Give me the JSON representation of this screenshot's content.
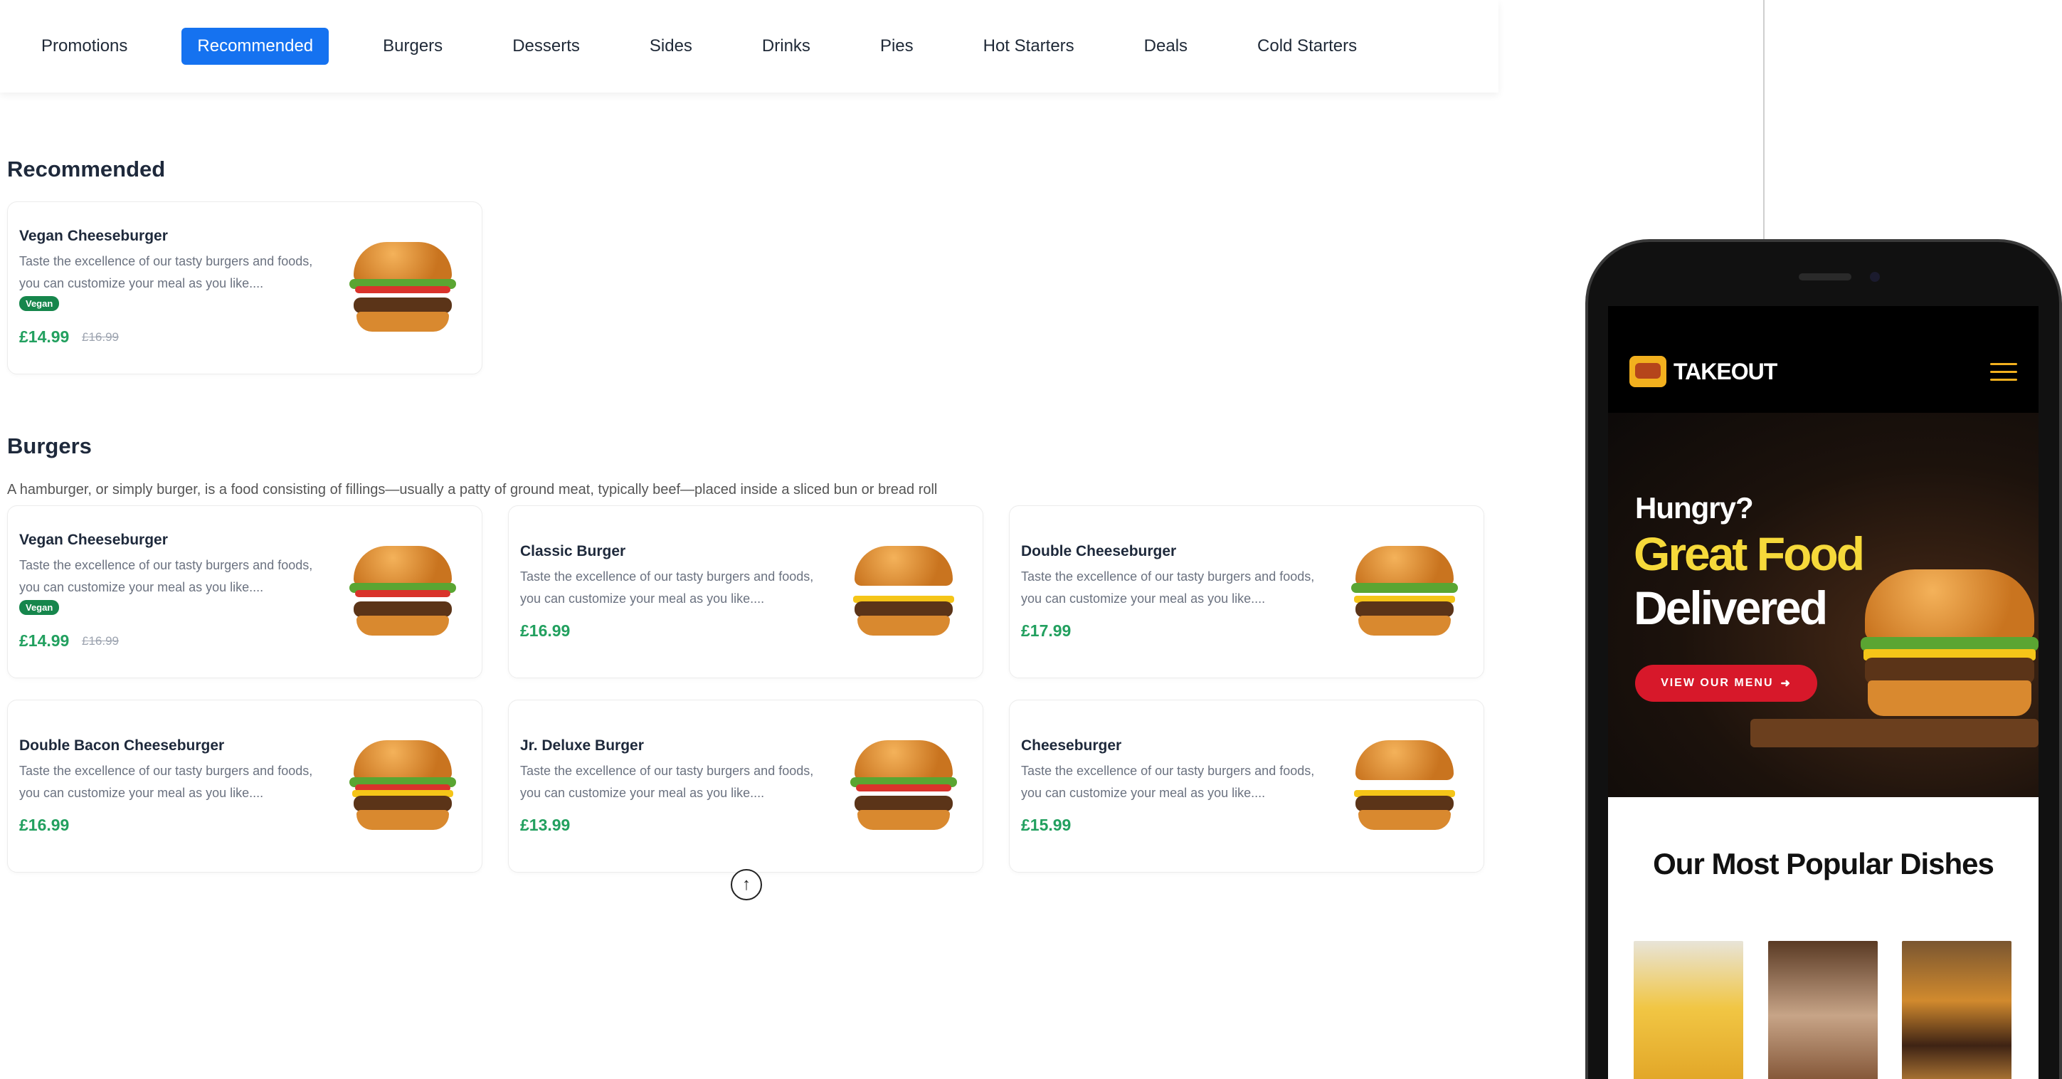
{
  "nav": {
    "items": [
      "Promotions",
      "Recommended",
      "Burgers",
      "Desserts",
      "Sides",
      "Drinks",
      "Pies",
      "Hot Starters",
      "Deals",
      "Cold Starters"
    ],
    "active": "Recommended"
  },
  "recommended": {
    "title": "Recommended",
    "items": [
      {
        "name": "Vegan Cheeseburger",
        "desc": "Taste the excellence of our tasty burgers and foods, you can customize your meal as you like....",
        "badge": "Vegan",
        "price": "£14.99",
        "old_price": "£16.99"
      }
    ]
  },
  "burgers": {
    "title": "Burgers",
    "description": "A hamburger, or simply burger, is a food consisting of fillings—usually a patty of ground meat, typically beef—placed inside a sliced bun or bread roll",
    "items": [
      {
        "name": "Vegan Cheeseburger",
        "desc": "Taste the excellence of our tasty burgers and foods, you can customize your meal as you like....",
        "badge": "Vegan",
        "price": "£14.99",
        "old_price": "£16.99"
      },
      {
        "name": "Classic Burger",
        "desc": "Taste the excellence of our tasty burgers and foods, you can customize your meal as you like....",
        "price": "£16.99"
      },
      {
        "name": "Double Cheeseburger",
        "desc": "Taste the excellence of our tasty burgers and foods, you can customize your meal as you like....",
        "price": "£17.99"
      },
      {
        "name": "Double Bacon Cheeseburger",
        "desc": "Taste the excellence of our tasty burgers and foods, you can customize your meal as you like....",
        "price": "£16.99"
      },
      {
        "name": "Jr. Deluxe Burger",
        "desc": "Taste the excellence of our tasty burgers and foods, you can customize your meal as you like....",
        "price": "£13.99"
      },
      {
        "name": "Cheeseburger",
        "desc": "Taste the excellence of our tasty burgers and foods, you can customize your meal as you like....",
        "price": "£15.99"
      }
    ]
  },
  "scroll_top_icon": "arrow-up-circle-icon",
  "phone": {
    "logo": "TAKEOUT",
    "hero_line1": "Hungry?",
    "hero_line2": "Great Food",
    "hero_line3": "Delivered",
    "cta": "VIEW OUR MENU",
    "popular_title": "Our Most Popular Dishes"
  },
  "colors": {
    "accent_blue": "#1572f0",
    "price_green": "#22a05f",
    "vegan_badge": "#16864c",
    "hero_yellow": "#f6d93a",
    "cta_red": "#d7182a"
  }
}
